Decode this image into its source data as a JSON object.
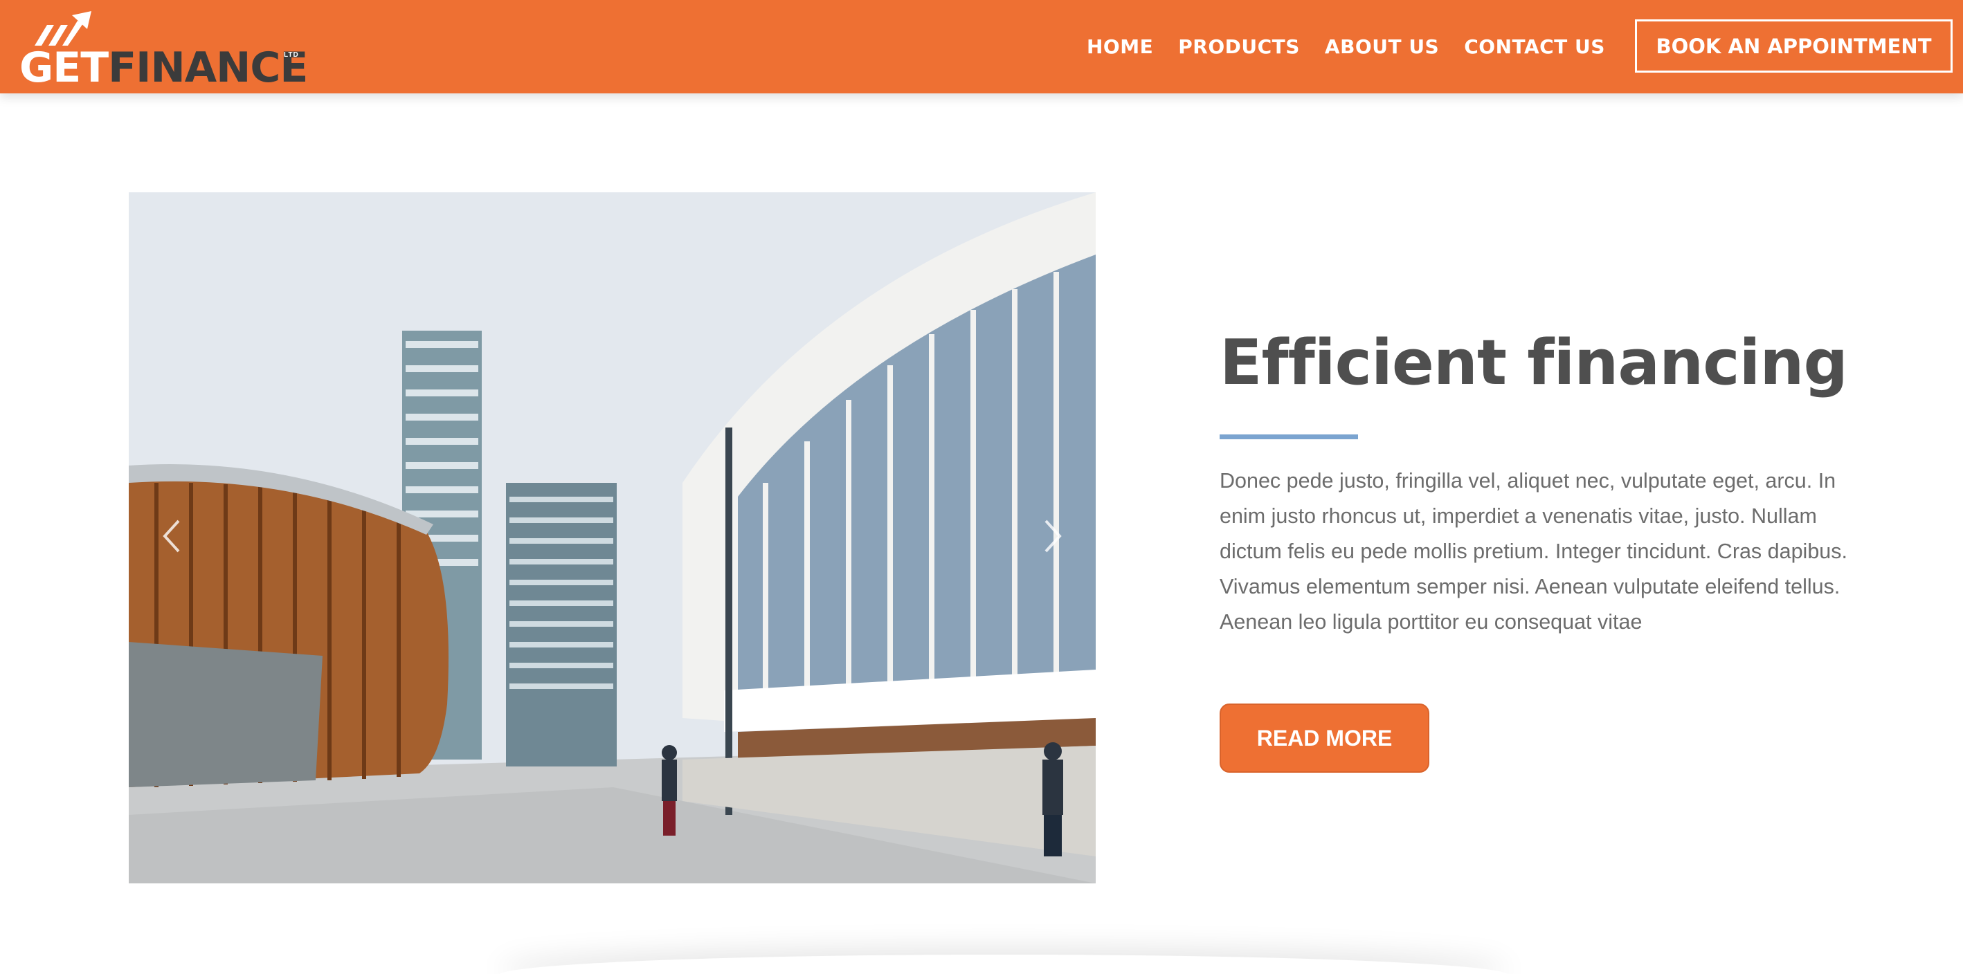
{
  "header": {
    "logo": {
      "get": "GET",
      "finance": "FINANCE",
      "ltd": "LTD"
    },
    "nav": [
      "HOME",
      "PRODUCTS",
      "ABOUT US",
      "CONTACT US"
    ],
    "cta": "BOOK AN APPOINTMENT"
  },
  "hero": {
    "title": "Efficient financing",
    "body": "Donec pede justo, fringilla vel, aliquet nec, vulputate eget, arcu. In enim justo rhoncus ut, imperdiet a venenatis vitae, justo. Nullam dictum felis eu pede mollis pretium. Integer tincidunt. Cras dapibus. Vivamus elementum semper nisi. Aenean vulputate eleifend tellus. Aenean leo ligula porttitor eu consequat vitae",
    "button": "READ MORE",
    "slider_icons": [
      "chevron-left-icon",
      "chevron-right-icon"
    ]
  },
  "colors": {
    "brand": "#ee7033",
    "divider": "#7ba4d0",
    "title": "#4f4f4f",
    "body": "#6c6c6c"
  }
}
